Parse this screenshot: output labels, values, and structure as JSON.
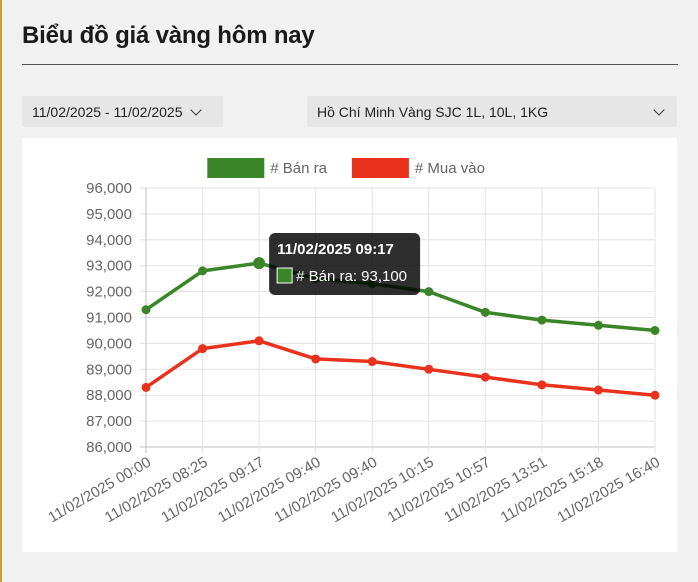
{
  "header": {
    "title": "Biểu đồ giá vàng hôm nay"
  },
  "filters": {
    "date_range": "11/02/2025 - 11/02/2025",
    "location": "Hồ Chí Minh Vàng SJC 1L, 10L, 1KG"
  },
  "chart_data": {
    "type": "line",
    "x": [
      "11/02/2025 00:00",
      "11/02/2025 08:25",
      "11/02/2025 09:17",
      "11/02/2025 09:40",
      "11/02/2025 09:40",
      "11/02/2025 10:15",
      "11/02/2025 10:57",
      "11/02/2025 13:51",
      "11/02/2025 15:18",
      "11/02/2025 16:40"
    ],
    "series": [
      {
        "name": "# Bán ra",
        "color": "#3a8527",
        "values": [
          91300,
          92800,
          93100,
          92500,
          92300,
          92000,
          91200,
          90900,
          90700,
          90500
        ]
      },
      {
        "name": "# Mua vào",
        "color": "#e8321e",
        "values": [
          88300,
          89800,
          90100,
          89400,
          89300,
          89000,
          88700,
          88400,
          88200,
          88000
        ]
      }
    ],
    "ylim": [
      86000,
      96000
    ],
    "yticks": [
      "86,000",
      "87,000",
      "88,000",
      "89,000",
      "90,000",
      "91,000",
      "92,000",
      "93,000",
      "94,000",
      "95,000",
      "96,000"
    ],
    "grid": true,
    "legend": "top",
    "tooltip": {
      "title": "11/02/2025 09:17",
      "label": "# Bán ra: 93,100",
      "point_index": 2,
      "series_index": 0
    }
  }
}
